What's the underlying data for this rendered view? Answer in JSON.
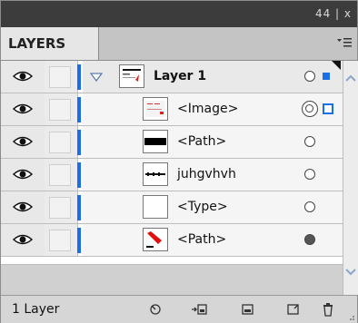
{
  "panel": {
    "title_controls": "44 | x",
    "tab_label": "LAYERS",
    "layer_count": "1 Layer"
  },
  "rows": [
    {
      "type": "layer",
      "name": "Layer 1",
      "thumb": "layer-thumb",
      "target": "single",
      "selected": true
    },
    {
      "type": "item",
      "name": "<Image>",
      "thumb": "image-thumb",
      "target": "double",
      "selected": true
    },
    {
      "type": "item",
      "name": "<Path>",
      "thumb": "black-bar-thumb",
      "target": "single",
      "selected": false
    },
    {
      "type": "item",
      "name": "juhgvhvh",
      "thumb": "text-thumb",
      "target": "single",
      "selected": false
    },
    {
      "type": "item",
      "name": "<Type>",
      "thumb": "blank-thumb",
      "target": "single",
      "selected": false
    },
    {
      "type": "item",
      "name": "<Path>",
      "thumb": "red-pin-thumb",
      "target": "filled",
      "selected": false
    }
  ],
  "footer_buttons": [
    "locate-object-icon",
    "make-clipping-mask-icon",
    "new-sublayer-icon",
    "new-layer-icon",
    "delete-icon"
  ],
  "colors": {
    "layer_color": "#1a6fe6",
    "titlebar": "#3c3c3c"
  }
}
